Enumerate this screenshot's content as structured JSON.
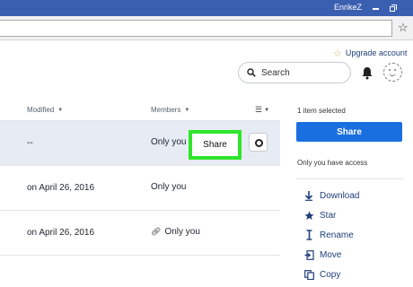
{
  "titlebar": {
    "user": "EnrikeZ"
  },
  "header": {
    "upgrade_label": "Upgrade account",
    "search_label": "Search"
  },
  "table": {
    "columns": {
      "modified": "Modified",
      "members": "Members"
    },
    "rows": [
      {
        "modified": "--",
        "members": "Only you",
        "selected": true
      },
      {
        "modified": "on April 26, 2016",
        "members": "Only you"
      },
      {
        "modified": "on April 26, 2016",
        "members": "Only you",
        "shared_link": true
      }
    ],
    "share_label": "Share"
  },
  "panel": {
    "selection": "1 item selected",
    "share_label": "Share",
    "access": "Only you have access",
    "actions": [
      {
        "label": "Download",
        "icon": "download-icon"
      },
      {
        "label": "Star",
        "icon": "star-icon"
      },
      {
        "label": "Rename",
        "icon": "rename-icon"
      },
      {
        "label": "Move",
        "icon": "move-icon"
      },
      {
        "label": "Copy",
        "icon": "copy-icon"
      }
    ]
  },
  "colors": {
    "titlebar": "#3b5fb0",
    "accent": "#1a6fe0",
    "highlight": "#2ee52a",
    "selected_row": "#e6ebf4"
  }
}
